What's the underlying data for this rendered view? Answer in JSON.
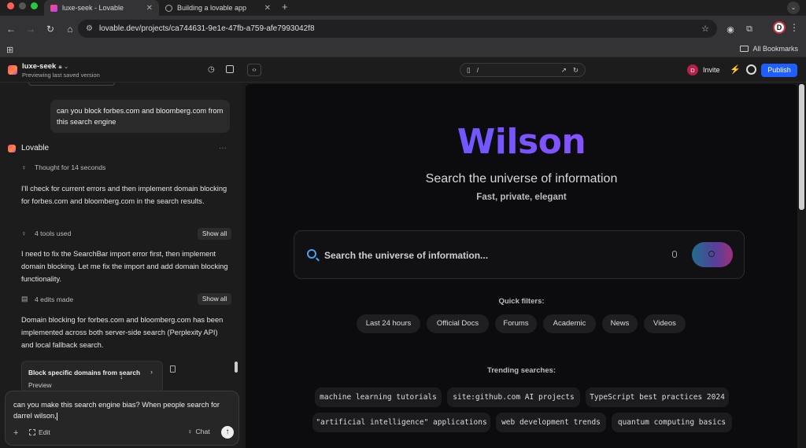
{
  "browser": {
    "tabs": [
      {
        "title": "luxe-seek - Lovable"
      },
      {
        "title": "Building a lovable app"
      }
    ],
    "new_tab": "+",
    "url": "lovable.dev/projects/ca744631-9e1e-47fb-a759-afe7993042f8",
    "profile_initial": "D",
    "bookmarks_label": "All Bookmarks"
  },
  "topbar": {
    "project_name": "luxe-seek",
    "status": "Previewing last saved version",
    "preview_path": "/",
    "invite_initial": "D",
    "invite_label": "Invite",
    "publish_label": "Publish"
  },
  "chat": {
    "user_message": "can you block forbes.com and bloomberg.com from this search engine",
    "assistant_name": "Lovable",
    "thought": "Thought for 14 seconds",
    "para1": "I'll check for current errors and then implement domain blocking for forbes.com and bloomberg.com in the search results.",
    "tools_used": "4 tools used",
    "show_all": "Show all",
    "para2": "I need to fix the SearchBar import error first, then implement domain blocking. Let me fix the import and add domain blocking functionality.",
    "edits_made": "4 edits made",
    "para3": "Domain blocking for forbes.com and bloomberg.com has been implemented across both server-side search (Perplexity API) and local fallback search.",
    "card_title": "Block specific domains from search",
    "card_sub": "Preview",
    "composer_text": "can you make this search engine bias? When people search for darrel wilson,",
    "edit_label": "Edit",
    "chat_label": "Chat"
  },
  "app": {
    "brand": "Wilson",
    "subtitle": "Search the universe of information",
    "tagline": "Fast, private, elegant",
    "search_placeholder": "Search the universe of information...",
    "quick_filters_label": "Quick filters:",
    "filters": [
      "Last 24 hours",
      "Official Docs",
      "Forums",
      "Academic",
      "News",
      "Videos"
    ],
    "trending_label": "Trending searches:",
    "trending": [
      "machine learning tutorials",
      "site:github.com AI projects",
      "TypeScript best practices 2024",
      "\"artificial intelligence\" applications",
      "web development trends",
      "quantum computing basics"
    ]
  }
}
